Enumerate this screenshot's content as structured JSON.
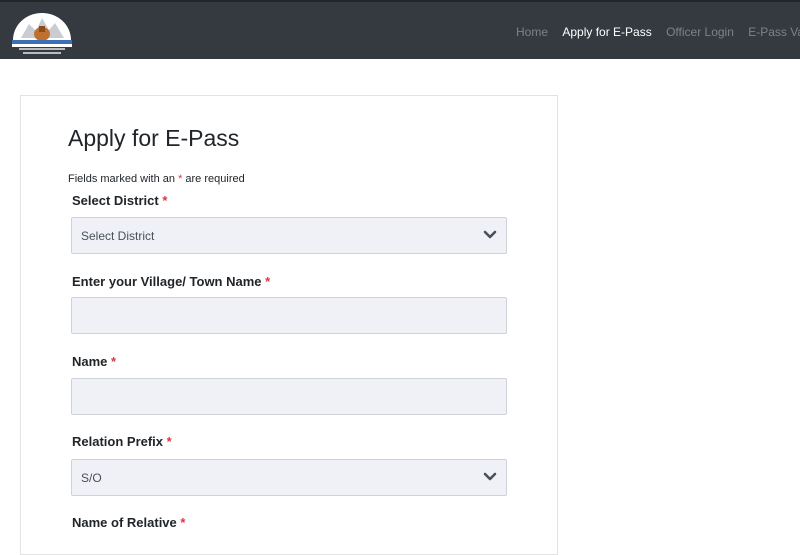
{
  "nav": {
    "items": [
      {
        "label": "Home",
        "active": false
      },
      {
        "label": "Apply for E-Pass",
        "active": true
      },
      {
        "label": "Officer Login",
        "active": false
      },
      {
        "label": "E-Pass Validit",
        "active": false
      }
    ]
  },
  "form": {
    "title": "Apply for E-Pass",
    "note_prefix": "Fields marked with an",
    "note_star": "*",
    "note_suffix": "are required",
    "fields": [
      {
        "label": "Select District",
        "star": "*",
        "type": "select",
        "value": "Select District"
      },
      {
        "label": "Enter your Village/ Town Name",
        "star": "*",
        "type": "text",
        "value": ""
      },
      {
        "label": "Name",
        "star": "*",
        "type": "text",
        "value": ""
      },
      {
        "label": "Relation Prefix",
        "star": "*",
        "type": "select",
        "value": "S/O"
      },
      {
        "label": "Name of Relative",
        "star": "*",
        "type": "text",
        "value": ""
      }
    ]
  },
  "colors": {
    "navbar": "#343a40",
    "required": "#dc3545",
    "input_bg": "#eff1f6"
  },
  "icons": {
    "logo": "emblem-logo-icon",
    "dropdown": "chevron-down-icon"
  }
}
